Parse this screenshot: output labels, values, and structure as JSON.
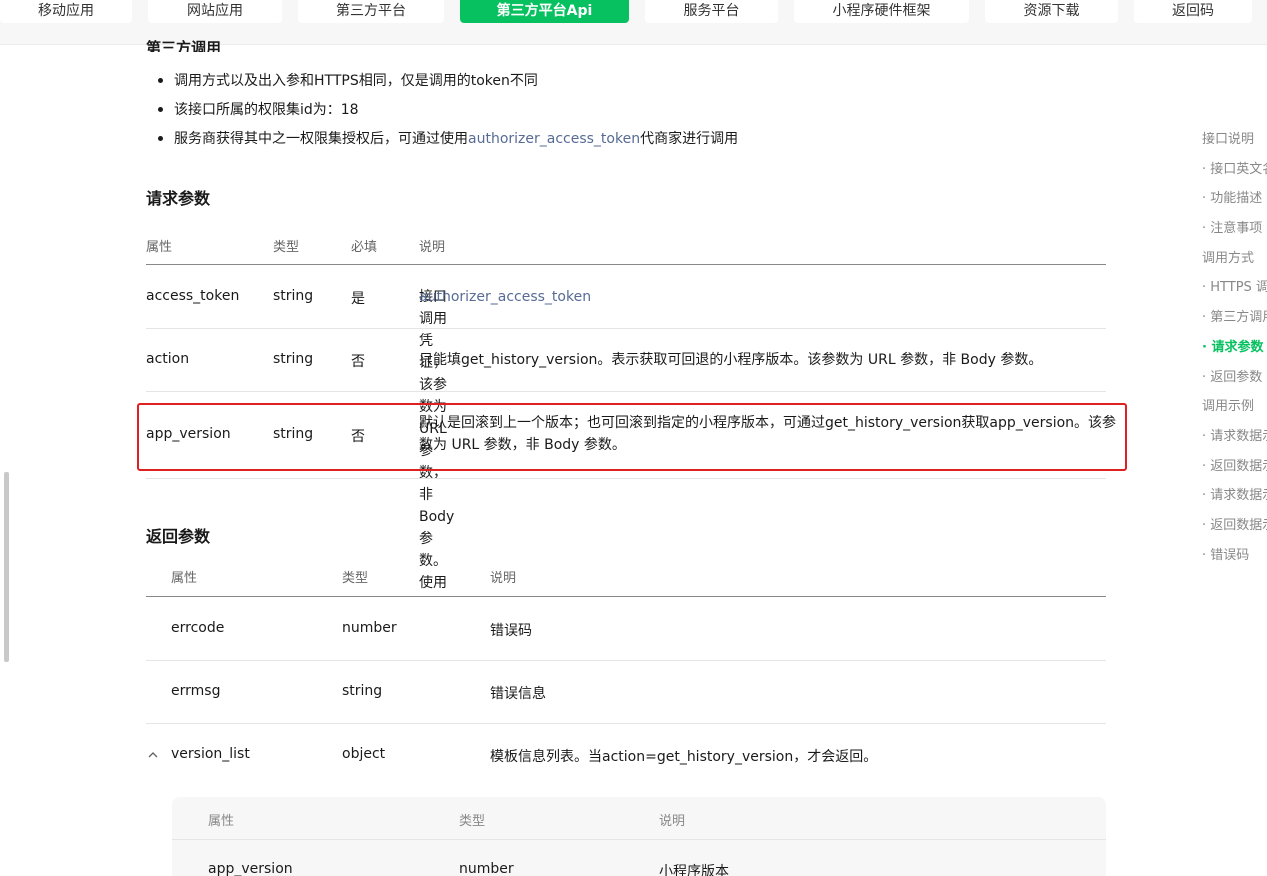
{
  "nav": {
    "tabs": [
      {
        "label": "移动应用"
      },
      {
        "label": "网站应用"
      },
      {
        "label": "第三方平台"
      },
      {
        "label": "第三方平台Api"
      },
      {
        "label": "服务平台"
      },
      {
        "label": "小程序硬件框架"
      },
      {
        "label": "资源下载"
      },
      {
        "label": "返回码"
      }
    ]
  },
  "section_top": {
    "title": "第三方调用",
    "bullets": [
      {
        "text": "调用方式以及出入参和HTTPS相同，仅是调用的token不同"
      },
      {
        "text": "该接口所属的权限集id为：18"
      },
      {
        "text_before": "服务商获得其中之一权限集授权后，可通过使用",
        "link": "authorizer_access_token",
        "text_after": "代商家进行调用"
      }
    ]
  },
  "request_params": {
    "title": "请求参数",
    "headers": {
      "name": "属性",
      "type": "类型",
      "required": "必填",
      "desc": "说明"
    },
    "rows": [
      {
        "name": "access_token",
        "type": "string",
        "required": "是",
        "desc": "接口调用凭证，该参数为 URL 参数，非 Body 参数。使用",
        "desc_link": "authorizer_access_token"
      },
      {
        "name": "action",
        "type": "string",
        "required": "否",
        "desc": "只能填get_history_version。表示获取可回退的小程序版本。该参数为 URL 参数，非 Body 参数。"
      },
      {
        "name": "app_version",
        "type": "string",
        "required": "否",
        "desc_line1": "默认是回滚到上一个版本；也可回滚到指定的小程序版本，可通过get_history_version获取app_version。该参",
        "desc_line2": "数为 URL 参数，非 Body 参数。"
      }
    ]
  },
  "return_params": {
    "title": "返回参数",
    "headers": {
      "name": "属性",
      "type": "类型",
      "desc": "说明"
    },
    "rows": [
      {
        "name": "errcode",
        "type": "number",
        "desc": "错误码"
      },
      {
        "name": "errmsg",
        "type": "string",
        "desc": "错误信息"
      },
      {
        "name": "version_list",
        "type": "object",
        "desc": "模板信息列表。当action=get_history_version，才会返回。",
        "expand_icon": "chevron-up-icon"
      }
    ],
    "sub": {
      "headers": {
        "name": "属性",
        "type": "类型",
        "desc": "说明"
      },
      "rows": [
        {
          "name": "app_version",
          "type": "number",
          "desc": "小程序版本"
        }
      ]
    }
  },
  "toc": {
    "items": [
      {
        "label": "接口说明"
      },
      {
        "label": "· 接口英文名"
      },
      {
        "label": "· 功能描述"
      },
      {
        "label": "· 注意事项"
      },
      {
        "label": "调用方式"
      },
      {
        "label": "· HTTPS 调用"
      },
      {
        "label": "· 第三方调用"
      },
      {
        "label": "· 请求参数"
      },
      {
        "label": "· 返回参数"
      },
      {
        "label": "调用示例"
      },
      {
        "label": "· 请求数据示例"
      },
      {
        "label": "· 返回数据示例"
      },
      {
        "label": "· 请求数据示例"
      },
      {
        "label": "· 返回数据示例"
      },
      {
        "label": "· 错误码"
      }
    ],
    "active_index": 7
  },
  "colors": {
    "accent": "#07c160",
    "link": "#576b95",
    "highlight_border": "#e02020"
  }
}
